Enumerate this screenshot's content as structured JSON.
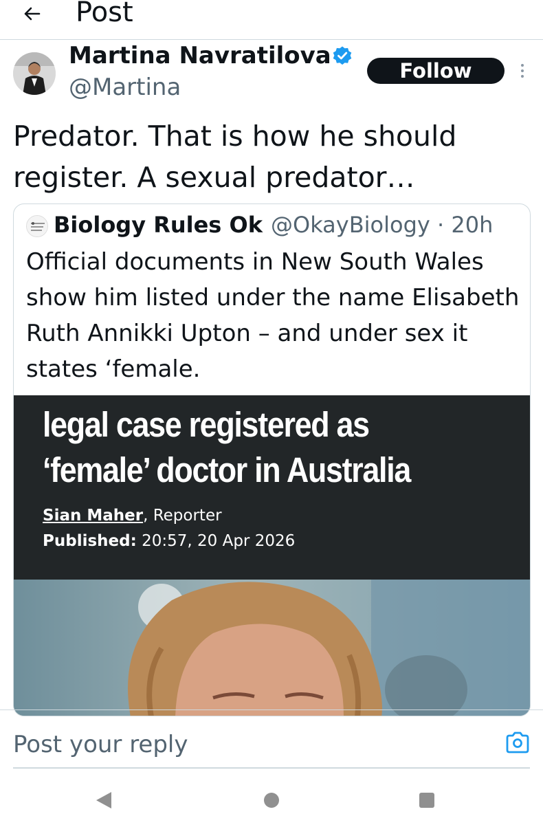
{
  "header": {
    "title": "Post",
    "back_icon": "arrow-left-icon"
  },
  "post": {
    "author_name": "Martina Navratilova",
    "author_handle": "@Martina",
    "verified_icon": "verified-badge-icon",
    "follow_label": "Follow",
    "more_icon": "more-vertical-icon",
    "text": "Predator. That is how he should register. A sexual predator…"
  },
  "quote": {
    "author_name": "Biology Rules Ok",
    "author_handle": "@OkayBiology · 20h",
    "text": "Official documents in New South Wales show him listed under the name Elisabeth Ruth Annikki Upton – and under sex it states ‘female.",
    "article": {
      "headline": "legal case registered as ‘female’ doctor in Australia",
      "byline_author": "Sian Maher",
      "byline_role": ", Reporter",
      "published_label": "Published:",
      "published_value": " 20:57, 20 Apr 2026"
    }
  },
  "reply": {
    "placeholder": "Post your reply",
    "camera_icon": "camera-icon"
  },
  "system_nav": {
    "back_icon": "nav-back-triangle-icon",
    "home_icon": "nav-home-circle-icon",
    "recent_icon": "nav-recent-square-icon"
  },
  "colors": {
    "accent": "#1d9bf0",
    "text_primary": "#0f1419",
    "text_secondary": "#536471",
    "border": "#cfd9de",
    "article_bg": "#222628"
  }
}
